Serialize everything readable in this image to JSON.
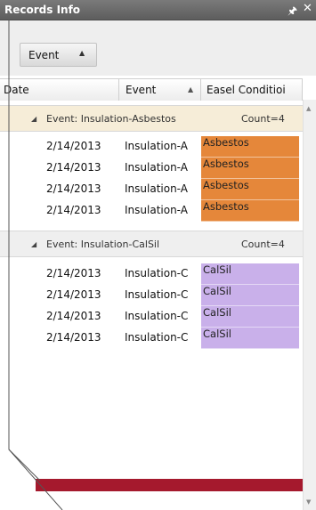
{
  "window": {
    "title": "Records Info",
    "pin_icon": "pin-icon",
    "close_icon": "close-icon"
  },
  "groupby": {
    "chip_label": "Event",
    "chip_sort": "ascending"
  },
  "columns": [
    {
      "label": "Date"
    },
    {
      "label": "Event",
      "sort": "ascending"
    },
    {
      "label": "Easel Conditioi"
    }
  ],
  "groups": [
    {
      "label": "Event: Insulation-Asbestos",
      "count": "Count=4",
      "color": "#e5873a",
      "rows": [
        {
          "date": "2/14/2013",
          "event": "Insulation-A",
          "condition": "Asbestos"
        },
        {
          "date": "2/14/2013",
          "event": "Insulation-A",
          "condition": "Asbestos"
        },
        {
          "date": "2/14/2013",
          "event": "Insulation-A",
          "condition": "Asbestos"
        },
        {
          "date": "2/14/2013",
          "event": "Insulation-A",
          "condition": "Asbestos"
        }
      ]
    },
    {
      "label": "Event: Insulation-CalSil",
      "count": "Count=4",
      "color": "#c9b0ea",
      "rows": [
        {
          "date": "2/14/2013",
          "event": "Insulation-C",
          "condition": "CalSil"
        },
        {
          "date": "2/14/2013",
          "event": "Insulation-C",
          "condition": "CalSil"
        },
        {
          "date": "2/14/2013",
          "event": "Insulation-C",
          "condition": "CalSil"
        },
        {
          "date": "2/14/2013",
          "event": "Insulation-C",
          "condition": "CalSil"
        }
      ]
    }
  ],
  "colors": {
    "titlebar": "#6b6b6b",
    "accent_band": "#a5192d",
    "group1_header": "#f6edd8"
  }
}
